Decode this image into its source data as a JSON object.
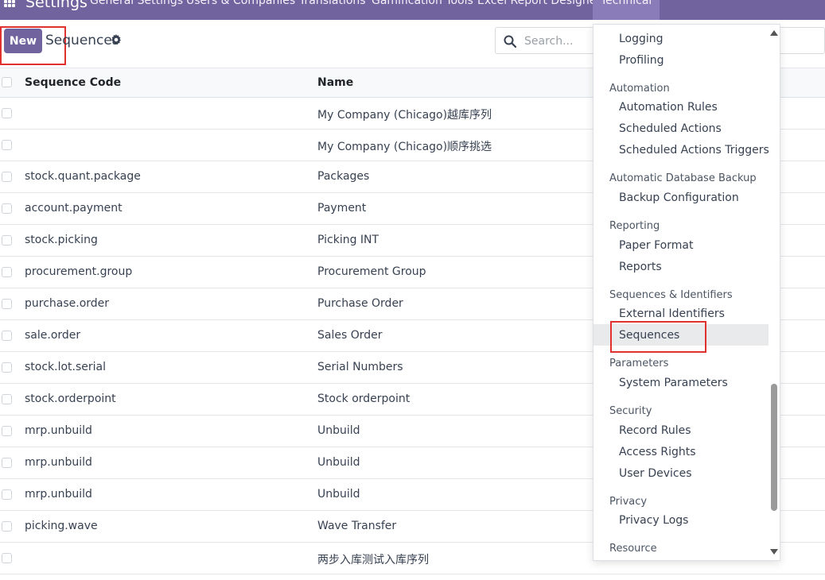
{
  "navbar": {
    "app_title": "Settings",
    "items": [
      {
        "label": "General Settings"
      },
      {
        "label": "Users & Companies"
      },
      {
        "label": "Translations"
      },
      {
        "label": "Gamification Tools"
      },
      {
        "label": "Excel Report Designer"
      },
      {
        "label": "Technical"
      }
    ]
  },
  "control": {
    "new_label": "New",
    "title": "Sequences",
    "search_placeholder": "Search..."
  },
  "table": {
    "headers": {
      "code": "Sequence Code",
      "name": "Name"
    },
    "rows": [
      {
        "code": "",
        "name": "My Company (Chicago)越库序列"
      },
      {
        "code": "",
        "name": "My Company (Chicago)顺序挑选"
      },
      {
        "code": "stock.quant.package",
        "name": "Packages"
      },
      {
        "code": "account.payment",
        "name": "Payment"
      },
      {
        "code": "stock.picking",
        "name": "Picking INT"
      },
      {
        "code": "procurement.group",
        "name": "Procurement Group"
      },
      {
        "code": "purchase.order",
        "name": "Purchase Order"
      },
      {
        "code": "sale.order",
        "name": "Sales Order"
      },
      {
        "code": "stock.lot.serial",
        "name": "Serial Numbers"
      },
      {
        "code": "stock.orderpoint",
        "name": "Stock orderpoint"
      },
      {
        "code": "mrp.unbuild",
        "name": "Unbuild"
      },
      {
        "code": "mrp.unbuild",
        "name": "Unbuild"
      },
      {
        "code": "mrp.unbuild",
        "name": "Unbuild"
      },
      {
        "code": "picking.wave",
        "name": "Wave Transfer"
      },
      {
        "code": "",
        "name": "两步入库测试入库序列"
      }
    ]
  },
  "menu": {
    "logging": "Logging",
    "profiling": "Profiling",
    "automation": "Automation",
    "automation_rules": "Automation Rules",
    "scheduled_actions": "Scheduled Actions",
    "scheduled_actions_triggers": "Scheduled Actions Triggers",
    "auto_backup": "Automatic Database Backup",
    "backup_configuration": "Backup Configuration",
    "reporting": "Reporting",
    "paper_format": "Paper Format",
    "reports": "Reports",
    "seq_identifiers": "Sequences & Identifiers",
    "external_identifiers": "External Identifiers",
    "sequences": "Sequences",
    "parameters": "Parameters",
    "system_parameters": "System Parameters",
    "security": "Security",
    "record_rules": "Record Rules",
    "access_rights": "Access Rights",
    "user_devices": "User Devices",
    "privacy": "Privacy",
    "privacy_logs": "Privacy Logs",
    "resource": "Resource"
  },
  "colors": {
    "brand": "#71639e",
    "highlight": "#e0312f"
  }
}
